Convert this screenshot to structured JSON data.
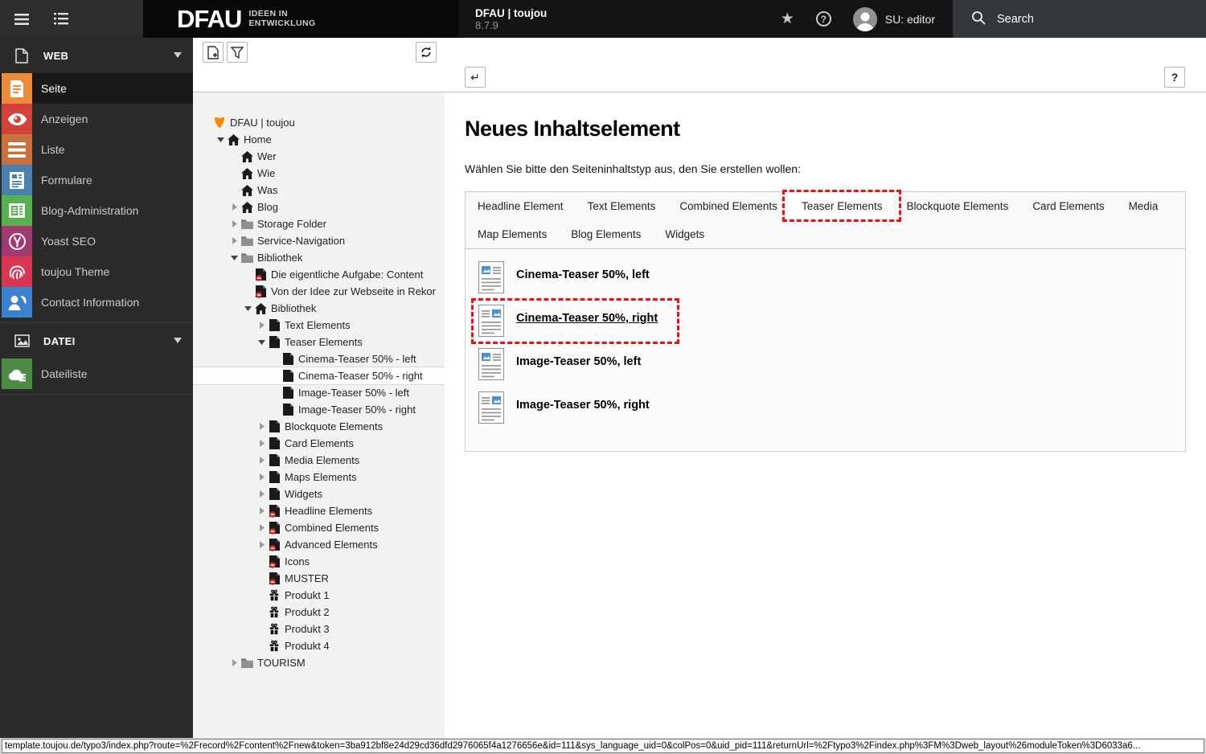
{
  "topbar": {
    "brand": {
      "name": "DFAU",
      "tagline_line1": "IDEEN IN",
      "tagline_line2": "ENTWICKLUNG"
    },
    "site": {
      "title": "DFAU | toujou",
      "version": "8.7.9"
    },
    "user": {
      "label": "SU: editor"
    },
    "search": {
      "label": "Search"
    }
  },
  "sidebar": {
    "sections": [
      {
        "id": "web",
        "label": "WEB",
        "icon": "web-section",
        "items": [
          {
            "label": "Seite",
            "icon": "doc",
            "color": "#ec8b3a",
            "active": true
          },
          {
            "label": "Anzeigen",
            "icon": "eye",
            "color": "#d24238",
            "active": false
          },
          {
            "label": "Liste",
            "icon": "list",
            "color": "#c9713a",
            "active": false
          },
          {
            "label": "Formulare",
            "icon": "form",
            "color": "#4a80ae",
            "active": false
          },
          {
            "label": "Blog-Administration",
            "icon": "news",
            "color": "#54b14e",
            "active": false
          },
          {
            "label": "Yoast SEO",
            "icon": "yoast",
            "color": "#a03a70",
            "active": false
          },
          {
            "label": "toujou Theme",
            "icon": "fingerprint",
            "color": "#d93652",
            "active": false
          },
          {
            "label": "Contact Information",
            "icon": "contact",
            "color": "#3a82cd",
            "active": false
          }
        ]
      },
      {
        "id": "datei",
        "label": "DATEI",
        "icon": "datei-section",
        "items": [
          {
            "label": "Dateiliste",
            "icon": "filelist",
            "color": "#4d8b44",
            "active": false
          }
        ]
      }
    ]
  },
  "pagetree": {
    "rows": [
      {
        "level": 0,
        "toggle": null,
        "icon": "typo3-logo",
        "label": "DFAU | toujou",
        "selected": false
      },
      {
        "level": 1,
        "toggle": "open",
        "icon": "home",
        "label": "Home",
        "selected": false
      },
      {
        "level": 2,
        "toggle": null,
        "icon": "home",
        "label": "Wer",
        "selected": false
      },
      {
        "level": 2,
        "toggle": null,
        "icon": "home",
        "label": "Wie",
        "selected": false
      },
      {
        "level": 2,
        "toggle": null,
        "icon": "home",
        "label": "Was",
        "selected": false
      },
      {
        "level": 2,
        "toggle": "closed",
        "icon": "home",
        "label": "Blog",
        "selected": false
      },
      {
        "level": 2,
        "toggle": "closed",
        "icon": "folder",
        "label": "Storage Folder",
        "selected": false
      },
      {
        "level": 2,
        "toggle": "closed",
        "icon": "folder",
        "label": "Service-Navigation",
        "selected": false
      },
      {
        "level": 2,
        "toggle": "open",
        "icon": "folder",
        "label": "Bibliothek",
        "selected": false
      },
      {
        "level": 3,
        "toggle": null,
        "icon": "page-hidden",
        "label": "Die eigentliche Aufgabe: Content",
        "selected": false
      },
      {
        "level": 3,
        "toggle": null,
        "icon": "page-hidden",
        "label": "Von der Idee zur Webseite in Rekor",
        "selected": false
      },
      {
        "level": 3,
        "toggle": "open",
        "icon": "home",
        "label": "Bibliothek",
        "selected": false
      },
      {
        "level": 4,
        "toggle": "closed",
        "icon": "page",
        "label": "Text Elements",
        "selected": false
      },
      {
        "level": 4,
        "toggle": "open",
        "icon": "page",
        "label": "Teaser Elements",
        "selected": false
      },
      {
        "level": 5,
        "toggle": null,
        "icon": "page",
        "label": "Cinema-Teaser 50% - left",
        "selected": false
      },
      {
        "level": 5,
        "toggle": null,
        "icon": "page",
        "label": "Cinema-Teaser 50% - right",
        "selected": true
      },
      {
        "level": 5,
        "toggle": null,
        "icon": "page",
        "label": "Image-Teaser 50% - left",
        "selected": false
      },
      {
        "level": 5,
        "toggle": null,
        "icon": "page",
        "label": "Image-Teaser 50% - right",
        "selected": false
      },
      {
        "level": 4,
        "toggle": "closed",
        "icon": "page",
        "label": "Blockquote Elements",
        "selected": false
      },
      {
        "level": 4,
        "toggle": "closed",
        "icon": "page",
        "label": "Card Elements",
        "selected": false
      },
      {
        "level": 4,
        "toggle": "closed",
        "icon": "page",
        "label": "Media Elements",
        "selected": false
      },
      {
        "level": 4,
        "toggle": "closed",
        "icon": "page",
        "label": "Maps Elements",
        "selected": false
      },
      {
        "level": 4,
        "toggle": "closed",
        "icon": "page",
        "label": "Widgets",
        "selected": false
      },
      {
        "level": 4,
        "toggle": "closed",
        "icon": "page-hidden",
        "label": "Headline Elements",
        "selected": false
      },
      {
        "level": 4,
        "toggle": "closed",
        "icon": "page-hidden",
        "label": "Combined Elements",
        "selected": false
      },
      {
        "level": 4,
        "toggle": "closed",
        "icon": "page-hidden",
        "label": "Advanced Elements",
        "selected": false
      },
      {
        "level": 4,
        "toggle": null,
        "icon": "page-hidden",
        "label": "Icons",
        "selected": false
      },
      {
        "level": 4,
        "toggle": null,
        "icon": "page-hidden",
        "label": "MUSTER",
        "selected": false
      },
      {
        "level": 4,
        "toggle": null,
        "icon": "gift",
        "label": "Produkt 1",
        "selected": false
      },
      {
        "level": 4,
        "toggle": null,
        "icon": "gift",
        "label": "Produkt 2",
        "selected": false
      },
      {
        "level": 4,
        "toggle": null,
        "icon": "gift",
        "label": "Produkt 3",
        "selected": false
      },
      {
        "level": 4,
        "toggle": null,
        "icon": "gift",
        "label": "Produkt 4",
        "selected": false
      },
      {
        "level": 2,
        "toggle": "closed",
        "icon": "folder",
        "label": "TOURISM",
        "selected": false
      }
    ]
  },
  "content": {
    "title": "Neues Inhaltselement",
    "subtitle": "Wählen Sie bitte den Seiteninhaltstyp aus, den Sie erstellen wollen:",
    "tabs_row1": [
      {
        "label": "Headline Element",
        "active": false,
        "annotated": false
      },
      {
        "label": "Text Elements",
        "active": false,
        "annotated": false
      },
      {
        "label": "Combined Elements",
        "active": false,
        "annotated": false
      },
      {
        "label": "Teaser Elements",
        "active": true,
        "annotated": true
      },
      {
        "label": "Blockquote Elements",
        "active": false,
        "annotated": false
      },
      {
        "label": "Card Elements",
        "active": false,
        "annotated": false
      },
      {
        "label": "Media",
        "active": false,
        "annotated": false
      }
    ],
    "tabs_row2": [
      {
        "label": "Map Elements",
        "active": false,
        "annotated": false
      },
      {
        "label": "Blog Elements",
        "active": false,
        "annotated": false
      },
      {
        "label": "Widgets",
        "active": false,
        "annotated": false
      }
    ],
    "items": [
      {
        "label": "Cinema-Teaser 50%, left",
        "variant": "left",
        "annotated": false,
        "underlined": false
      },
      {
        "label": "Cinema-Teaser 50%, right",
        "variant": "right",
        "annotated": true,
        "underlined": true
      },
      {
        "label": "Image-Teaser 50%, left",
        "variant": "left",
        "annotated": false,
        "underlined": false
      },
      {
        "label": "Image-Teaser 50%, right",
        "variant": "right",
        "annotated": false,
        "underlined": false
      }
    ]
  },
  "statusbar": {
    "url": "template.toujou.de/typo3/index.php?route=%2Frecord%2Fcontent%2Fnew&token=3ba912bf8e24d29cd36dfd2976065f4a1276656e&id=111&sys_language_uid=0&colPos=0&uid_pid=111&returnUrl=%2Ftypo3%2Findex.php%3FM%3Dweb_layout%26moduleToken%3D6033a6..."
  },
  "colors": {
    "annotation_red": "#ed1111",
    "ce_icon_blue": "#4a90d9",
    "typo3_orange": "#ff8700"
  }
}
